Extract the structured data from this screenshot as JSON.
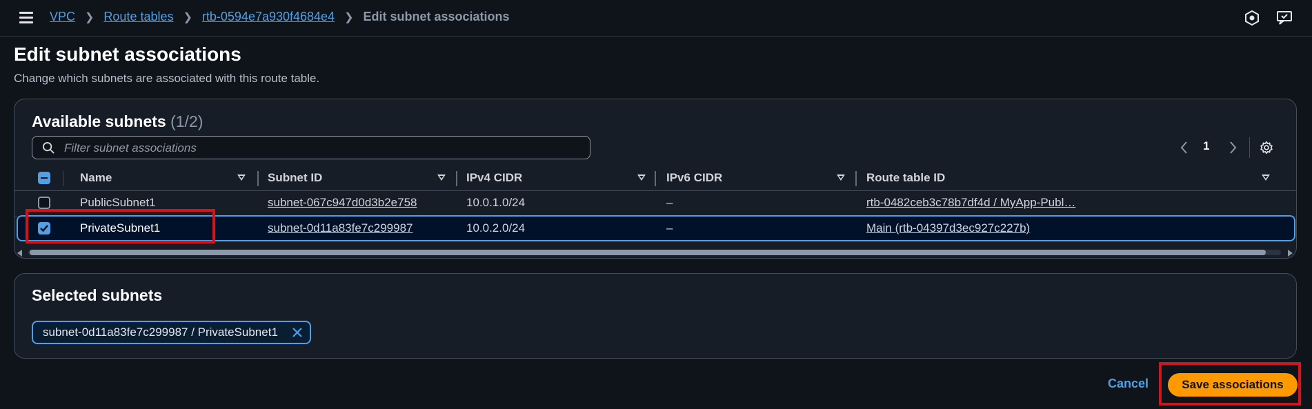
{
  "breadcrumb": {
    "items": [
      "VPC",
      "Route tables",
      "rtb-0594e7a930f4684e4"
    ],
    "current": "Edit subnet associations"
  },
  "page": {
    "title": "Edit subnet associations",
    "description": "Change which subnets are associated with this route table."
  },
  "available": {
    "title": "Available subnets",
    "count": "(1/2)",
    "filter_placeholder": "Filter subnet associations",
    "page_number": "1",
    "columns": [
      "Name",
      "Subnet ID",
      "IPv4 CIDR",
      "IPv6 CIDR",
      "Route table ID"
    ],
    "rows": [
      {
        "checked": false,
        "name": "PublicSubnet1",
        "subnet_id": "subnet-067c947d0d3b2e758",
        "ipv4": "10.0.1.0/24",
        "ipv6": "–",
        "route_table": "rtb-0482ceb3c78b7df4d / MyApp-Publ…"
      },
      {
        "checked": true,
        "name": "PrivateSubnet1",
        "subnet_id": "subnet-0d11a83fe7c299987",
        "ipv4": "10.0.2.0/24",
        "ipv6": "–",
        "route_table": "Main (rtb-04397d3ec927c227b)"
      }
    ]
  },
  "selected": {
    "title": "Selected subnets",
    "tokens": [
      "subnet-0d11a83fe7c299987 / PrivateSubnet1"
    ]
  },
  "actions": {
    "cancel": "Cancel",
    "save": "Save associations"
  },
  "colors": {
    "accent": "#539fe5",
    "primary_button": "#ff9900",
    "highlight_box": "#d6121a"
  }
}
